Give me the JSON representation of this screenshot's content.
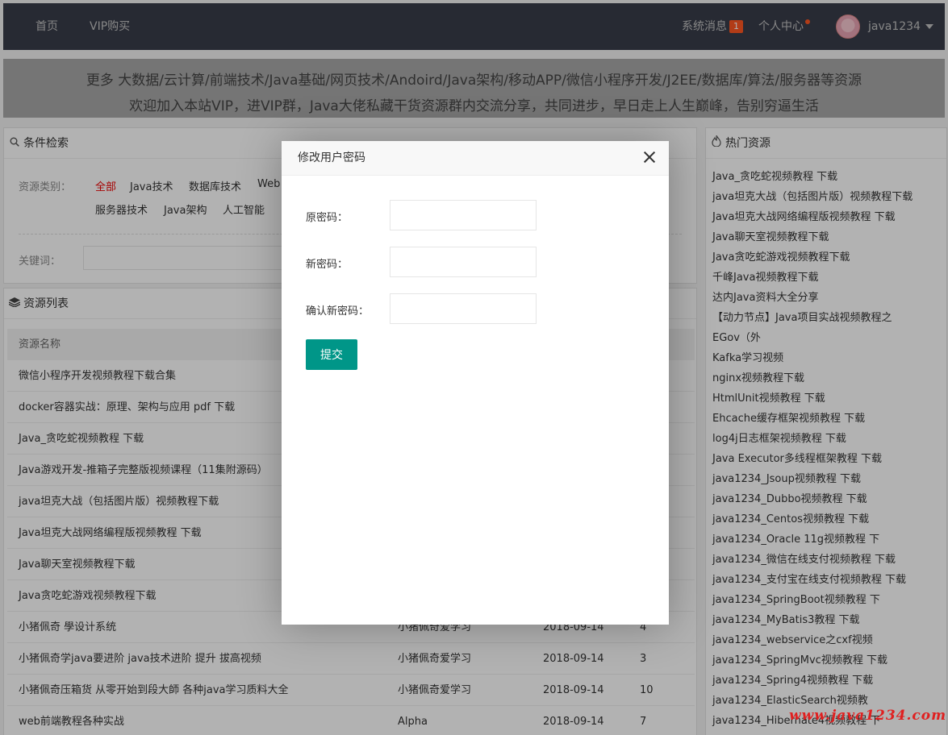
{
  "nav": {
    "home": "首页",
    "vip": "VIP购买",
    "messages": "系统消息",
    "messages_count": "1",
    "user_center": "个人中心",
    "username": "java1234"
  },
  "banner": {
    "line1": "更多 大数据/云计算/前端技术/Java基础/网页技术/Andoird/Java架构/移动APP/微信小程序开发/J2EE/数据库/算法/服务器等资源",
    "line2": "欢迎加入本站VIP，进VIP群，Java大佬私藏干货资源群内交流分享，共同进步，早日走上人生巅峰，告别穷逼生活"
  },
  "search": {
    "title": "条件检索",
    "category_label": "资源类别：",
    "categories": [
      "全部",
      "Java技术",
      "数据库技术",
      "Web",
      "服务器技术",
      "Java架构",
      "人工智能"
    ],
    "keyword_label": "关键词："
  },
  "resources": {
    "title": "资源列表",
    "column_name": "资源名称",
    "rows": [
      {
        "name": "微信小程序开发视频教程下载合集",
        "author": "",
        "date": "",
        "count": ""
      },
      {
        "name": "docker容器实战：原理、架构与应用 pdf 下载",
        "author": "",
        "date": "",
        "count": ""
      },
      {
        "name": "Java_贪吃蛇视频教程 下载",
        "author": "",
        "date": "",
        "count": ""
      },
      {
        "name": "Java游戏开发-推箱子完整版视频课程（11集附源码）",
        "author": "",
        "date": "",
        "count": ""
      },
      {
        "name": "java坦克大战（包括图片版）视频教程下载",
        "author": "",
        "date": "",
        "count": ""
      },
      {
        "name": "Java坦克大战网络编程版视频教程 下载",
        "author": "",
        "date": "",
        "count": ""
      },
      {
        "name": "Java聊天室视频教程下载",
        "author": "",
        "date": "",
        "count": ""
      },
      {
        "name": "Java贪吃蛇游戏视频教程下载",
        "author": "",
        "date": "",
        "count": ""
      },
      {
        "name": "小猪佩奇 學设计系统",
        "author": "小猪佩奇爱学习",
        "date": "2018-09-14",
        "count": "4"
      },
      {
        "name": "小猪佩奇学java要进阶 java技术进阶 提升 拔高视频",
        "author": "小猪佩奇爱学习",
        "date": "2018-09-14",
        "count": "3"
      },
      {
        "name": "小猪佩奇压箱货 从零开始到段大師 各种java学习质料大全",
        "author": "小猪佩奇爱学习",
        "date": "2018-09-14",
        "count": "10"
      },
      {
        "name": "web前端教程各种实战",
        "author": "Alpha",
        "date": "2018-09-14",
        "count": "7"
      }
    ]
  },
  "hot": {
    "title": "热门资源",
    "items": [
      "Java_贪吃蛇视频教程 下载",
      "java坦克大战（包括图片版）视频教程下载",
      "Java坦克大战网络编程版视频教程 下载",
      "Java聊天室视频教程下载",
      "Java贪吃蛇游戏视频教程下载",
      "千峰Java视频教程下载",
      "达内Java资料大全分享",
      "【动力节点】Java项目实战视频教程之",
      "EGov（外",
      "Kafka学习视频",
      "nginx视频教程下载",
      "HtmlUnit视频教程 下载",
      "Ehcache缓存框架视频教程 下载",
      "log4j日志框架视频教程 下载",
      "Java Executor多线程框架教程 下载",
      "java1234_Jsoup视频教程 下载",
      "java1234_Dubbo视频教程 下载",
      "java1234_Centos视频教程 下载",
      "java1234_Oracle 11g视频教程 下",
      "java1234_微信在线支付视频教程 下载",
      "java1234_支付宝在线支付视频教程 下载",
      "java1234_SpringBoot视频教程 下",
      "java1234_MyBatis3教程 下载",
      "java1234_webservice之cxf视频",
      "java1234_SpringMvc视频教程 下载",
      "java1234_Spring4视频教程 下载",
      "java1234_ElasticSearch视频教",
      "java1234_Hibernate4视频教程 下"
    ]
  },
  "modal": {
    "title": "修改用户密码",
    "old_password_label": "原密码：",
    "new_password_label": "新密码：",
    "confirm_password_label": "确认新密码：",
    "submit_label": "提交"
  },
  "watermark": "www.java1234.com"
}
